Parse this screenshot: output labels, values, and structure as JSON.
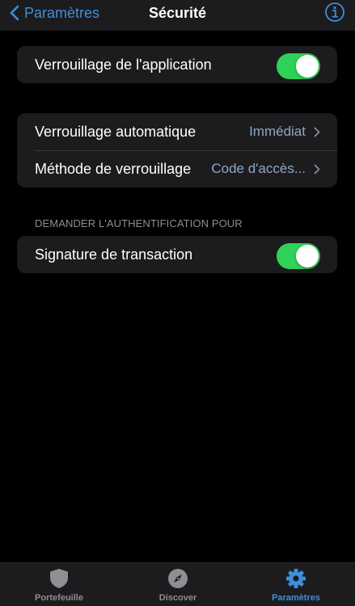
{
  "nav": {
    "back_label": "Paramètres",
    "title": "Sécurité",
    "info_icon": "info-icon"
  },
  "app_lock": {
    "label": "Verrouillage de l'application",
    "enabled": true
  },
  "lock_settings": {
    "auto_lock": {
      "label": "Verrouillage automatique",
      "value": "Immédiat"
    },
    "lock_method": {
      "label": "Méthode de verrouillage",
      "value": "Code d'accès..."
    }
  },
  "auth_section": {
    "header": "DEMANDER L'AUTHENTIFICATION POUR",
    "transaction_signing": {
      "label": "Signature de transaction",
      "enabled": true
    }
  },
  "tabbar": {
    "tabs": [
      {
        "label": "Portefeuille",
        "icon": "shield-icon",
        "active": false
      },
      {
        "label": "Discover",
        "icon": "compass-icon",
        "active": false
      },
      {
        "label": "Paramètres",
        "icon": "gear-icon",
        "active": true
      }
    ]
  },
  "colors": {
    "accent": "#3d8fdc",
    "toggle_on": "#30d158",
    "background": "#000000",
    "cell": "#1c1c1e"
  }
}
